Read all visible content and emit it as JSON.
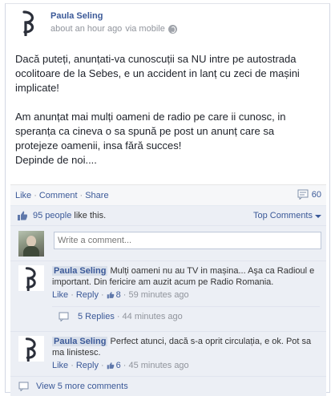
{
  "post": {
    "author": "Paula Seling",
    "time": "about an hour ago",
    "via": "via mobile",
    "privacy_icon": "globe-icon",
    "paragraphs": [
      "Dacă puteți, anunțati-va cunoscuții sa NU intre pe autostrada ocolitoare de la Sebes, e un accident in lanț cu zeci de mașini implicate!",
      "Am anunțat mai mulți oameni de radio pe care ii cunosc, in speranța ca cineva o sa spună pe post un anunț care sa protejeze oamenii, insa fără succes!\nDepinde de noi...."
    ]
  },
  "actions": {
    "like": "Like",
    "comment": "Comment",
    "share": "Share",
    "separator": "·",
    "comment_count": "60",
    "comment_count_icon": "comment-bubble-icon"
  },
  "likes": {
    "count_text": "95 people",
    "suffix": " like this.",
    "icon": "thumbs-up-icon",
    "top_comments_label": "Top Comments"
  },
  "composer": {
    "placeholder": "Write a comment..."
  },
  "comments": [
    {
      "author": "Paula Seling",
      "text": "Mulți oameni nu au TV in mașina... Aşa ca Radioul e important. Din fericire am auzit acum pe Radio Romania.",
      "like": "Like",
      "reply": "Reply",
      "likes": "8",
      "time": "59 minutes ago",
      "replies_label": "5 Replies",
      "replies_time": "44 minutes ago"
    },
    {
      "author": "Paula Seling",
      "text": "Perfect atunci, dacă s-a oprit circulația, e ok. Pot sa ma linistesc.",
      "like": "Like",
      "reply": "Reply",
      "likes": "6",
      "time": "45 minutes ago"
    }
  ],
  "view_more": "View 5 more comments",
  "colors": {
    "link": "#3b5998",
    "ufi_background": "#eceff5",
    "name_highlight": "#d8dfea"
  }
}
